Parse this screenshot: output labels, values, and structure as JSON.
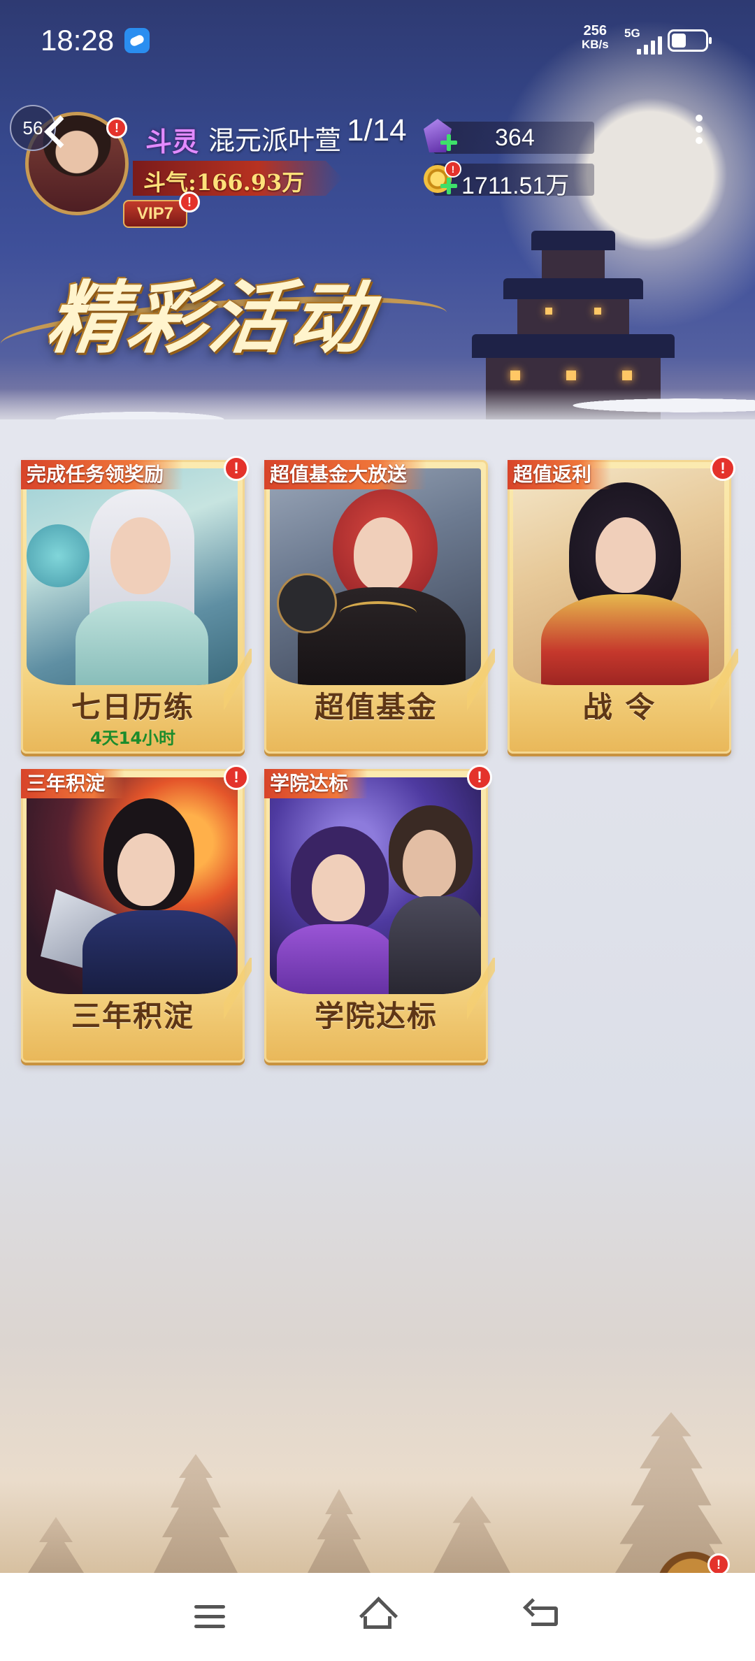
{
  "status_bar": {
    "time": "18:28",
    "net_speed_value": "256",
    "net_speed_unit": "KB/s",
    "network": "5G"
  },
  "header": {
    "level": "56",
    "rank": "斗灵",
    "player_name": "混元派叶萱",
    "progress": "1/14",
    "power_label": "斗气:166.93万",
    "vip": "VIP7",
    "gems": "364",
    "coins": "1711.51万",
    "alert_mark": "!"
  },
  "page": {
    "title": "精彩活动"
  },
  "cards": [
    {
      "ribbon": "完成任务领奖励",
      "title": "七日历练",
      "subtitle": "4天14小时"
    },
    {
      "ribbon": "超值基金大放送",
      "title": "超值基金",
      "subtitle": ""
    },
    {
      "ribbon": "超值返利",
      "title": "战 令",
      "subtitle": ""
    },
    {
      "ribbon": "三年积淀",
      "title": "三年积淀",
      "subtitle": ""
    },
    {
      "ribbon": "学院达标",
      "title": "学院达标",
      "subtitle": ""
    }
  ],
  "colors": {
    "accent_gold": "#f6d889",
    "ribbon_red": "#d8442a",
    "alert_red": "#e4322b",
    "timer_green": "#1c8c2c"
  },
  "icons": [
    "back-arrow-icon",
    "more-dots-icon",
    "gem-icon",
    "coin-icon",
    "plus-icon",
    "menu-icon",
    "home-icon",
    "back-icon"
  ]
}
